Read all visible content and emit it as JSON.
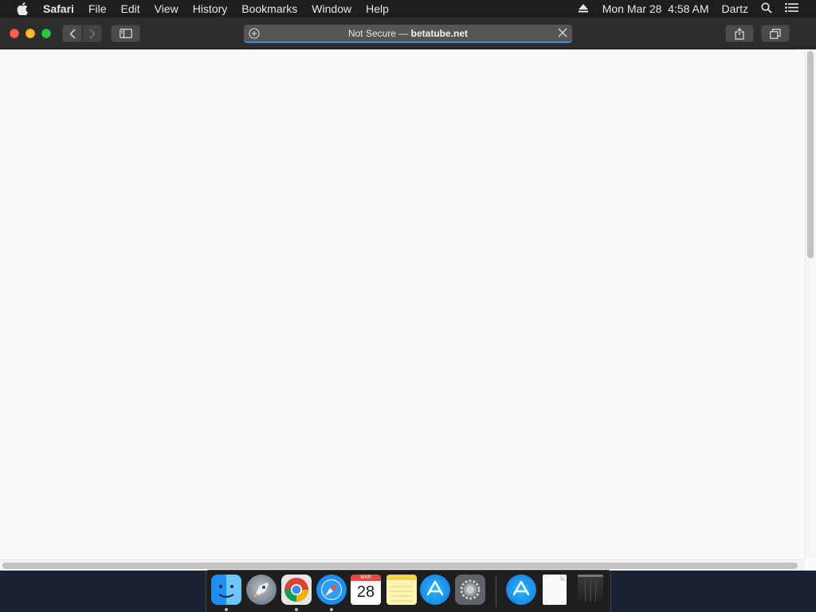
{
  "menubar": {
    "app_name": "Safari",
    "menus": [
      "File",
      "Edit",
      "View",
      "History",
      "Bookmarks",
      "Window",
      "Help"
    ],
    "clock": "Mon Mar 28  4:58 AM",
    "user": "Dartz",
    "icons": [
      "apple-icon",
      "eject-icon",
      "spotlight-icon",
      "notification-center-icon"
    ]
  },
  "toolbar": {
    "address_prefix": "Not Secure — ",
    "address_domain": "betatube.net"
  },
  "dock": {
    "calendar_month": "MAR",
    "calendar_day": "28",
    "apps": [
      "finder",
      "launchpad",
      "chrome",
      "safari",
      "calendar",
      "notes",
      "app-store",
      "system-preferences",
      "app-store",
      "document",
      "trash"
    ]
  }
}
